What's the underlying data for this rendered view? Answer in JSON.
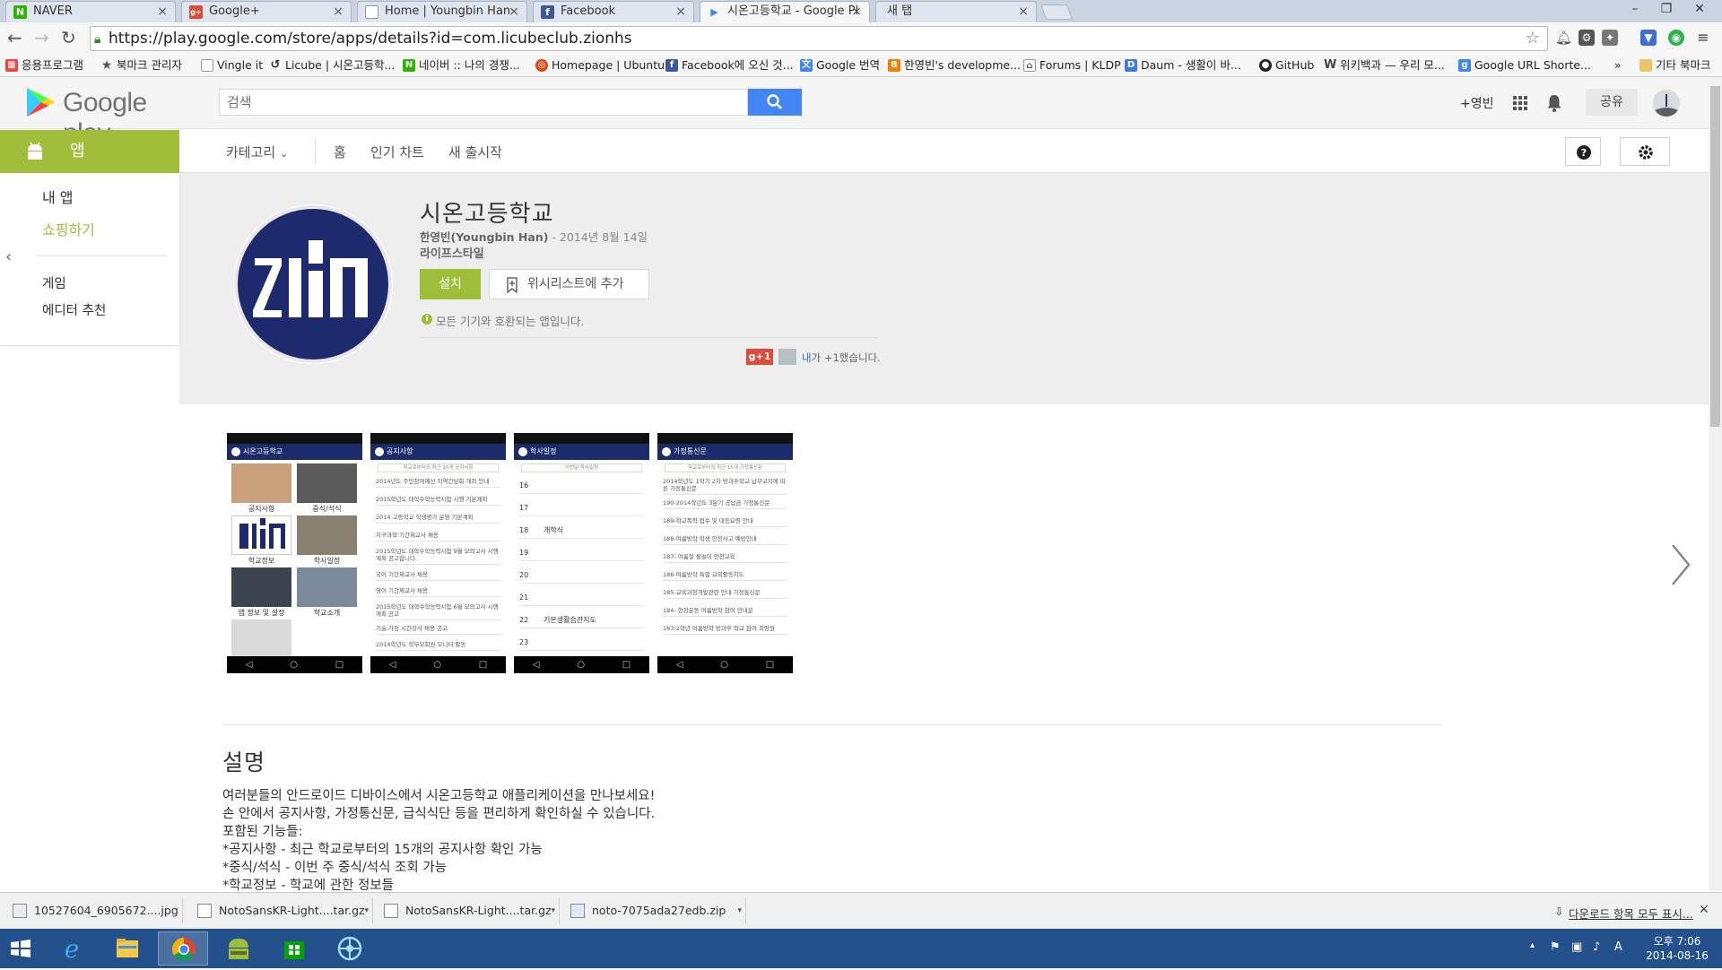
{
  "tabs": [
    {
      "title": "NAVER",
      "fav_letter": "N",
      "fav_color": "#2db400"
    },
    {
      "title": "Google+",
      "fav_letter": "g+",
      "fav_color": "#dd4b39"
    },
    {
      "title": "Home | Youngbin Han",
      "fav_letter": "",
      "fav_color": "#ffffff"
    },
    {
      "title": "Facebook",
      "fav_letter": "f",
      "fav_color": "#3b5998"
    },
    {
      "title": "시온고등학교 - Google Pl",
      "fav_letter": "▶",
      "fav_color": "#4285f4"
    },
    {
      "title": "새 탭",
      "fav_letter": "",
      "fav_color": "#dfe5ee"
    }
  ],
  "omnibox": {
    "url": "https://play.google.com/store/apps/details?id=com.licubeclub.zionhs"
  },
  "bookmarks": [
    {
      "label": "응용프로그램",
      "icon": "apps-grid-icon",
      "color": "#e44"
    },
    {
      "label": "북마크 관리자",
      "icon": "star-icon",
      "color": "#555"
    },
    {
      "label": "Vingle it",
      "icon": "page-icon",
      "color": "#999"
    },
    {
      "label": "Licube | 시온고등학...",
      "icon": "licube-icon",
      "color": "#333"
    },
    {
      "label": "네이버 :: 나의 경쟁...",
      "icon": "naver-icon",
      "color": "#2db400"
    },
    {
      "label": "Homepage | Ubuntu",
      "icon": "ubuntu-icon",
      "color": "#dd4814"
    },
    {
      "label": "Facebook에 오신 것...",
      "icon": "facebook-icon",
      "color": "#3b5998"
    },
    {
      "label": "Google 번역",
      "icon": "translate-icon",
      "color": "#4285f4"
    },
    {
      "label": "한영빈's developme...",
      "icon": "blogger-icon",
      "color": "#f57d00"
    },
    {
      "label": "Forums | KLDP",
      "icon": "forum-icon",
      "color": "#556"
    },
    {
      "label": "Daum - 생활이 바...",
      "icon": "daum-icon",
      "color": "#3b7dd8"
    },
    {
      "label": "GitHub",
      "icon": "github-icon",
      "color": "#222"
    },
    {
      "label": "위키백과 — 우리 모...",
      "icon": "wikipedia-icon",
      "color": "#444"
    },
    {
      "label": "Google URL Shorte...",
      "icon": "google-url-icon",
      "color": "#4285f4"
    }
  ],
  "bookmarks_overflow": "»",
  "other_bookmarks": "기타 북마크",
  "header": {
    "logo_text": "Google play",
    "search_placeholder": "검색",
    "plus_user": "+영빈",
    "share": "공유"
  },
  "catbar": {
    "apps_tab": "앱",
    "categories": "카테고리",
    "home": "홈",
    "top_charts": "인기 차트",
    "new_releases": "새 출시작"
  },
  "sidebar": {
    "my_apps": "내 앱",
    "shop": "쇼핑하기",
    "games": "게임",
    "editors_choice": "에디터 추천"
  },
  "app": {
    "title": "시온고등학교",
    "developer": "한영빈(Youngbin Han)",
    "date": " - 2014년 8월 14일",
    "category": "라이프스타일",
    "install": "설치",
    "wishlist": "위시리스트에 추가",
    "compat": "모든 기기와 호환되는 앱입니다.",
    "plusone_badge": "g+1",
    "plusone_me": "내",
    "plusone_rest": "가 +1했습니다."
  },
  "screenshots": {
    "shot1": {
      "title": "시온고등학교",
      "tiles": [
        "공지사항",
        "중식/석식",
        "학교정보",
        "학사일정",
        "앱 정보 및 설정",
        "학교소개"
      ]
    },
    "shot2": {
      "title": "공지사항",
      "sub": "학교로부터의 최근 15개 공지사항",
      "items": [
        "2014년도 주민참여예산 지역간담회 개최 안내",
        "2015학년도 대학수학능력시험 시행 기본계획",
        "2014 고등학교 학생평가 운영 기본계획",
        "지구과학 기간제교사 채용",
        "2015학년도 대학수학능력시험 9월 모의고사 시행 계획 공고합니다.",
        "국어 기간제교사 채용",
        "영어 기간제교사 채용",
        "2015학년도 대학수학능력시험 6월 모의고사 시행 계획 공고",
        "기술,가정 시간강사 채용 공고",
        "2014학년도 학부모회원 모니터 활동"
      ]
    },
    "shot3": {
      "title": "학사일정",
      "sub": "이번달 학사일정",
      "rows": [
        {
          "day": "16",
          "event": ""
        },
        {
          "day": "17",
          "event": ""
        },
        {
          "day": "18",
          "event": "개학식"
        },
        {
          "day": "19",
          "event": ""
        },
        {
          "day": "20",
          "event": ""
        },
        {
          "day": "21",
          "event": ""
        },
        {
          "day": "22",
          "event": "기본생활습관지도"
        },
        {
          "day": "23",
          "event": ""
        }
      ]
    },
    "shot4": {
      "title": "가정통신문",
      "sub": "학교로부터의 최근 15개 가정통신문",
      "items": [
        "2014학년도 1학기 2차 방과후학교 납부고지에 따른 가정통신문",
        "190-2014학년도 3분기 공납금 가정통신문",
        "189-학교폭력 접수 및 대응요령 안내",
        "188-여름방학 학생 안전사고 예방안내",
        "187- 여름철 물놀이 안전교육",
        "186-여름방학 특별 교외활동지도",
        "185-교육과정개발관련 안내 가정통신문",
        "184- 현장운동 여름방학 참여 안내문",
        "183-2학년 여름방학 방과후 학교 참여 희망원"
      ]
    }
  },
  "description": {
    "title": "설명",
    "lines": [
      "여러분들의 안드로이드 디바이스에서 시온고등학교 애플리케이션을 만나보세요!",
      "손 안에서 공지사항, 가정통신문, 급식식단 등을 편리하게 확인하실 수 있습니다.",
      "포함된 기능들:",
      "*공지사항 - 최근 학교로부터의 15개의 공지사항 확인 가능",
      "*중식/석식 - 이번 주 중식/석식 조회 가능",
      "*학교정보 - 학교에 관한 정보들"
    ]
  },
  "downloads": [
    {
      "name": "10527604_6905672....jpg"
    },
    {
      "name": "NotoSansKR-Light....tar.gz"
    },
    {
      "name": "NotoSansKR-Light....tar.gz"
    },
    {
      "name": "noto-7075ada27edb.zip"
    }
  ],
  "shelf": {
    "show_all": "다운로드 항목 모두 표시..."
  },
  "clock": {
    "time": "오후 7:06",
    "date": "2014-08-16"
  },
  "tray": {
    "ime": "A"
  },
  "colors": {
    "play_green": "#9fbf3b",
    "search_blue": "#4285f4",
    "taskbar": "#24508c"
  }
}
